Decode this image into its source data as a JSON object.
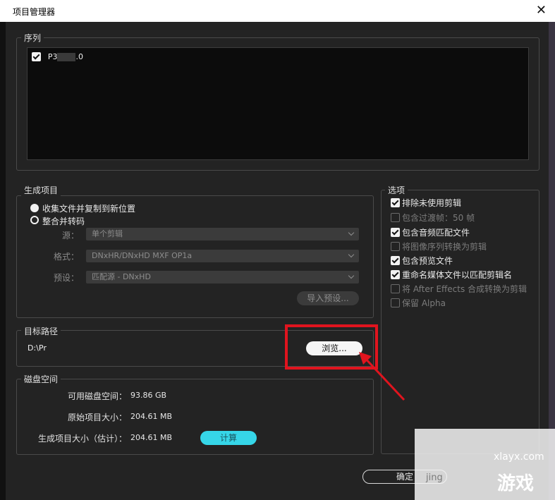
{
  "window": {
    "title": "项目管理器",
    "close_icon": "close-icon"
  },
  "sequence": {
    "label": "序列",
    "items": [
      {
        "name": "P3",
        "suffix": ".0",
        "checked": true
      }
    ]
  },
  "output": {
    "label": "生成项目",
    "radio_collect": "收集文件并复制到新位置",
    "radio_consolidate": "整合并转码",
    "source_label": "源：",
    "source_value": "单个剪辑",
    "format_label": "格式：",
    "format_value": "DNxHR/DNxHD MXF OP1a",
    "preset_label": "预设：",
    "preset_value": "匹配源 - DNxHD",
    "import_preset_button": "导入预设..."
  },
  "options": {
    "label": "选项",
    "items": [
      {
        "label": "排除未使用剪辑",
        "checked": true,
        "enabled": true
      },
      {
        "label": "包含过渡帧：50 帧",
        "checked": false,
        "enabled": false
      },
      {
        "label": "包含音频匹配文件",
        "checked": true,
        "enabled": true
      },
      {
        "label": "将图像序列转换为剪辑",
        "checked": false,
        "enabled": false
      },
      {
        "label": "包含预览文件",
        "checked": true,
        "enabled": true
      },
      {
        "label": "重命名媒体文件以匹配剪辑名",
        "checked": true,
        "enabled": true
      },
      {
        "label": "将 After Effects 合成转换为剪辑",
        "checked": false,
        "enabled": false
      },
      {
        "label": "保留 Alpha",
        "checked": false,
        "enabled": false
      }
    ]
  },
  "destination": {
    "label": "目标路径",
    "path": "D:\\Pr",
    "browse_button": "浏览..."
  },
  "disk": {
    "label": "磁盘空间",
    "available_label": "可用磁盘空间：",
    "available_value": "93.86 GB",
    "original_label": "原始项目大小：",
    "original_value": "204.61 MB",
    "result_label": "生成项目大小（估计）：",
    "result_value": "204.61 MB",
    "calc_button": "计算"
  },
  "footer": {
    "ok_button": "确定"
  },
  "watermark": {
    "site": "xlayx.com",
    "brand": "游戏",
    "prefix": "jing"
  },
  "colors": {
    "accent": "#36d6e8",
    "highlight": "#e0141e"
  }
}
